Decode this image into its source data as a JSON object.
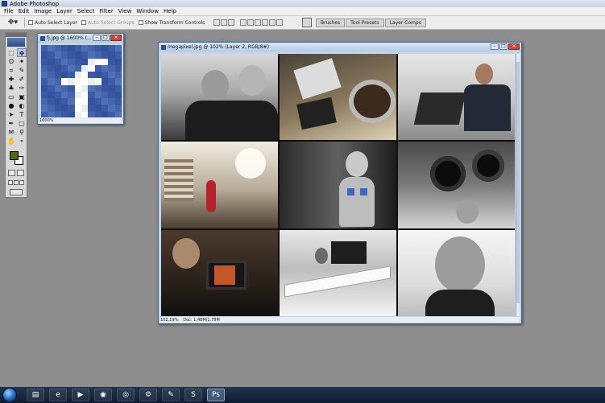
{
  "app": {
    "title": "Adobe Photoshop"
  },
  "menu": [
    "File",
    "Edit",
    "Image",
    "Layer",
    "Select",
    "Filter",
    "View",
    "Window",
    "Help"
  ],
  "options_bar": {
    "auto_select_layer": "Auto Select Layer",
    "auto_select_groups": "Auto Select Groups",
    "show_transform_controls": "Show Transform Controls",
    "palette_tabs": [
      "Brushes",
      "Tool Presets",
      "Layer Comps"
    ]
  },
  "colors": {
    "foreground": "#4e6b12",
    "background": "#ffffff",
    "accent": "#3b5ca8"
  },
  "documents": {
    "fb": {
      "title": "fj.jpg @ 1600% (...",
      "zoom": "1600%"
    },
    "main": {
      "title": "megapixel.jpg @ 102% (Layer 2, RGB/8#)",
      "zoom": "102,19%",
      "doc_size": "Doc: 1,48M/1,78M"
    }
  },
  "taskbar": {
    "apps": [
      "explorer-icon",
      "ie-icon",
      "media-player-icon",
      "firefox-icon",
      "chrome-icon",
      "network-app-icon",
      "paint-icon",
      "skype-icon",
      "photoshop-icon"
    ]
  }
}
